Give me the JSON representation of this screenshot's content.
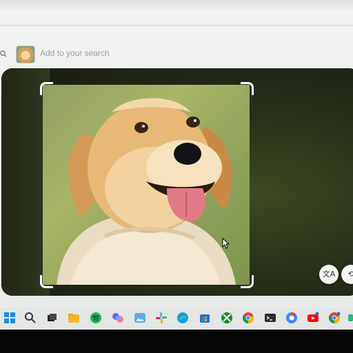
{
  "search": {
    "placeholder": "Add to your search"
  },
  "lens": {
    "translate_button_glyph": "文A",
    "second_button_glyph": "⟲"
  },
  "colors": {
    "panel_bg": "#1f2419",
    "selection_corners": "#ffffff",
    "taskbar_bg": "#e3e6e5"
  },
  "taskbar": {
    "icons": [
      "windows-start-icon",
      "search-icon",
      "task-view-icon",
      "file-explorer-icon",
      "spotify-icon",
      "copilot-icon",
      "photos-icon",
      "slack-icon",
      "edge-icon",
      "store-icon",
      "xbox-icon",
      "chrome-icon",
      "terminal-icon",
      "chrome-profile-icon",
      "youtube-icon",
      "chrome-alt-icon"
    ]
  }
}
